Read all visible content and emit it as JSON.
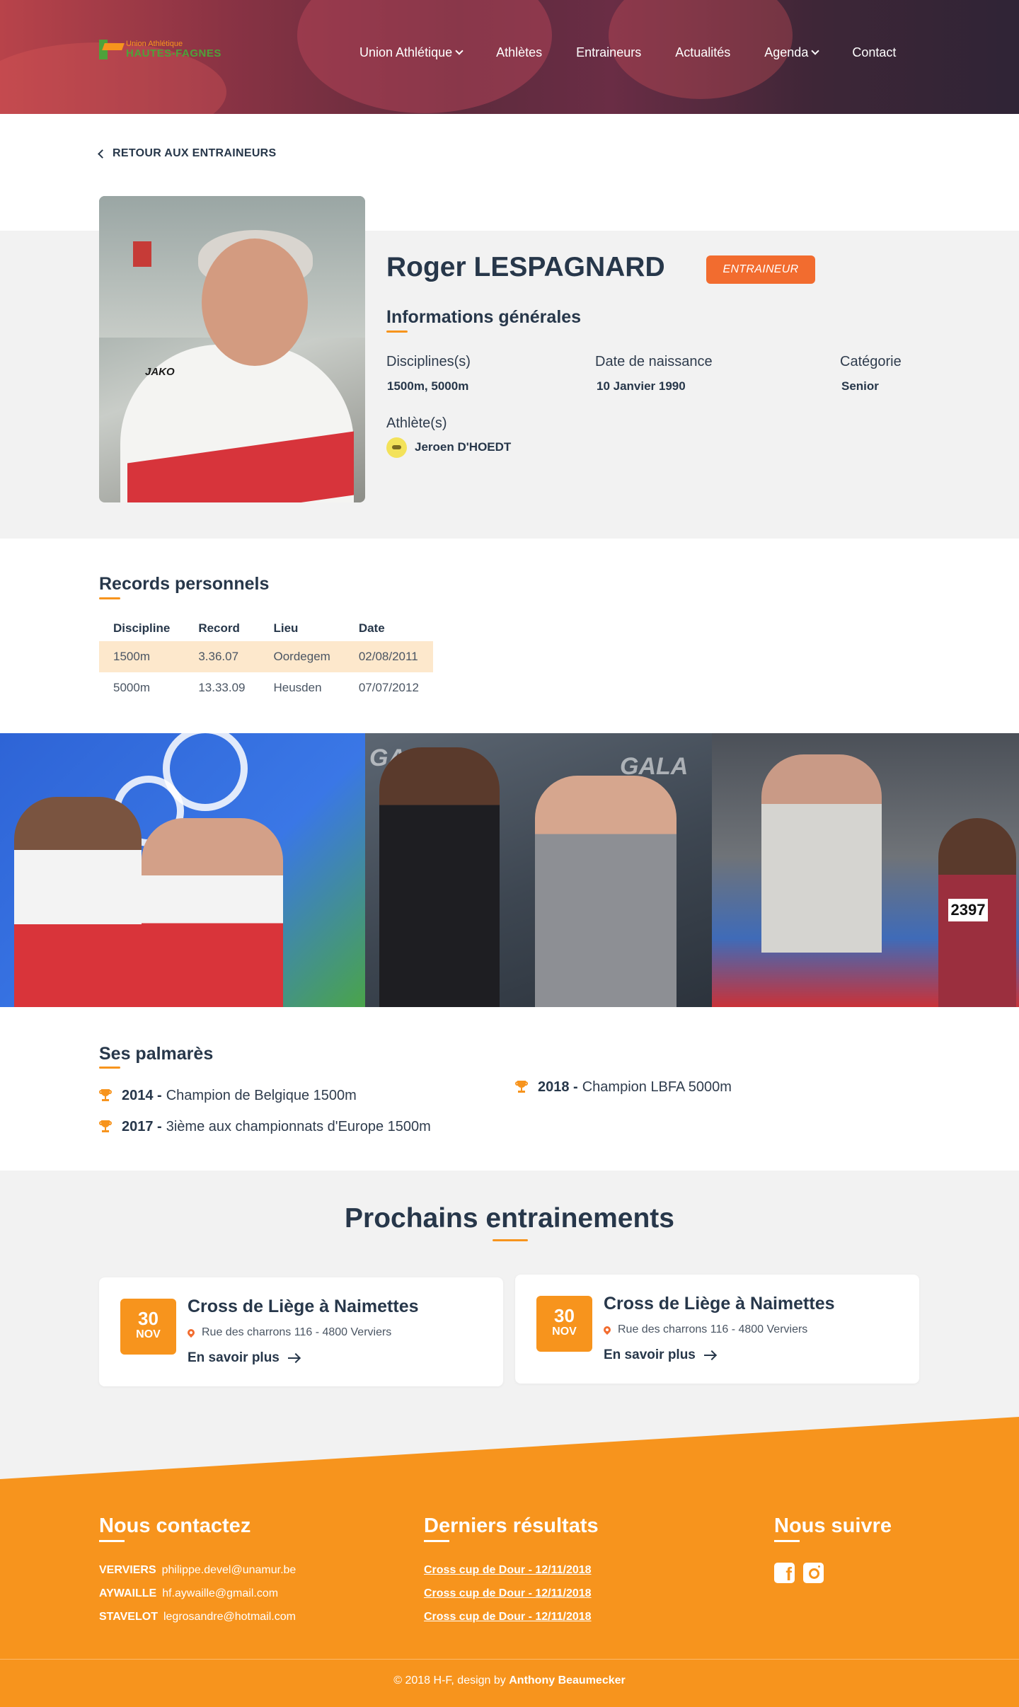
{
  "brand": {
    "line1": "Union Athlétique",
    "line2": "HAUTES-FAGNES"
  },
  "nav": {
    "items": [
      "Union Athlétique",
      "Athlètes",
      "Entraineurs",
      "Actualités",
      "Agenda",
      "Contact"
    ]
  },
  "back_link": "RETOUR AUX ENTRAINEURS",
  "profile": {
    "name": "Roger LESPAGNARD",
    "badge": "ENTRAINEUR",
    "info_title": "Informations générales",
    "disciplines_label": "Disciplines(s)",
    "disciplines_value": "1500m, 5000m",
    "birth_label": "Date de naissance",
    "birth_value": "10 Janvier 1990",
    "category_label": "Catégorie",
    "category_value": "Senior",
    "athletes_label": "Athlète(s)",
    "athlete_name": "Jeroen D'HOEDT"
  },
  "photo_label": "JAKO",
  "records": {
    "title": "Records personnels",
    "headers": [
      "Discipline",
      "Record",
      "Lieu",
      "Date"
    ],
    "rows": [
      [
        "1500m",
        "3.36.07",
        "Oordegem",
        "02/08/2011"
      ],
      [
        "5000m",
        "13.33.09",
        "Heusden",
        "07/07/2012"
      ]
    ]
  },
  "gallery": {
    "bib": "2397",
    "gala1": "GALA",
    "gala2": "GALA"
  },
  "palmares": {
    "title": "Ses palmarès",
    "items": [
      {
        "year": "2014 -",
        "text": "Champion de Belgique 1500m"
      },
      {
        "year": "2017 -",
        "text": "3ième aux championnats d'Europe 1500m"
      },
      {
        "year": "2018 -",
        "text": "Champion LBFA 5000m"
      }
    ]
  },
  "trainings": {
    "title": "Prochains entrainements",
    "cards": [
      {
        "day": "30",
        "month": "NOV",
        "title": "Cross de Liège à Naimettes",
        "address": "Rue des charrons 116 - 4800 Verviers",
        "more": "En savoir plus"
      },
      {
        "day": "30",
        "month": "NOV",
        "title": "Cross de Liège à Naimettes",
        "address": "Rue des charrons 116 - 4800 Verviers",
        "more": "En savoir plus"
      }
    ]
  },
  "footer": {
    "contact_title": "Nous contactez",
    "contacts": [
      {
        "city": "VERVIERS",
        "email": "philippe.devel@unamur.be"
      },
      {
        "city": "AYWAILLE",
        "email": "hf.aywaille@gmail.com"
      },
      {
        "city": "STAVELOT",
        "email": "legrosandre@hotmail.com"
      }
    ],
    "results_title": "Derniers résultats",
    "results": [
      "Cross cup de Dour - 12/11/2018",
      "Cross cup de Dour - 12/11/2018",
      "Cross cup de Dour - 12/11/2018"
    ],
    "follow_title": "Nous suivre",
    "copyright": "© 2018 H-F, design by",
    "designer": "Anthony Beaumecker"
  },
  "colors": {
    "accent": "#f7941d",
    "badge": "#f26c2f",
    "navy": "#27374a"
  }
}
